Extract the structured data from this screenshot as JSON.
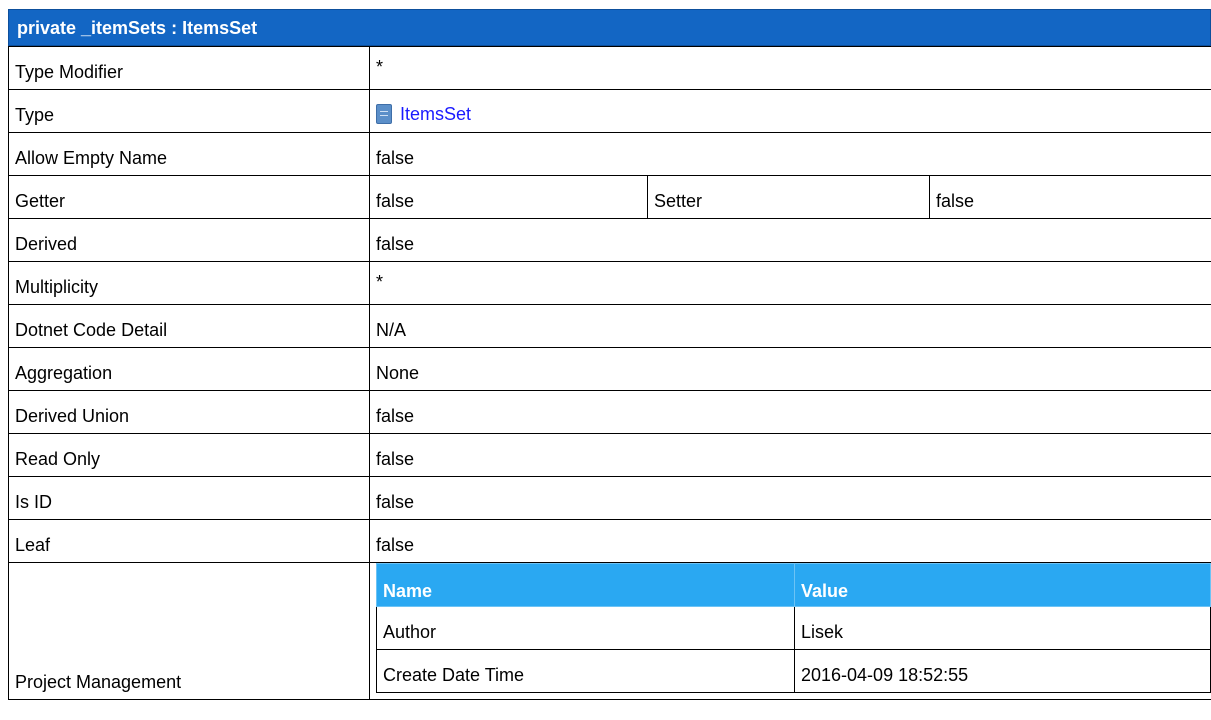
{
  "header": {
    "title": "private _itemSets : ItemsSet"
  },
  "properties": [
    {
      "label": "Type Modifier",
      "value": "*"
    },
    {
      "label": "Type",
      "value": "ItemsSet",
      "icon": "class-icon"
    },
    {
      "label": "Allow Empty Name",
      "value": "false"
    },
    {
      "label": "Getter",
      "value": "false",
      "extra_label": "Setter",
      "extra_value": "false"
    },
    {
      "label": "Derived",
      "value": "false"
    },
    {
      "label": "Multiplicity",
      "value": "*"
    },
    {
      "label": "Dotnet Code Detail",
      "value": "N/A"
    },
    {
      "label": "Aggregation",
      "value": "None"
    },
    {
      "label": "Derived Union",
      "value": "false"
    },
    {
      "label": "Read Only",
      "value": "false"
    },
    {
      "label": "Is ID",
      "value": "false"
    },
    {
      "label": "Leaf",
      "value": "false"
    }
  ],
  "project_management": {
    "label": "Project Management",
    "columns": [
      "Name",
      "Value"
    ],
    "rows": [
      [
        "Author",
        "Lisek"
      ],
      [
        "Create Date Time",
        "2016-04-09 18:52:55"
      ]
    ]
  },
  "colors": {
    "title_bar": "#1366c4",
    "sub_header": "#2aa8f2",
    "link": "#1a1aff"
  }
}
